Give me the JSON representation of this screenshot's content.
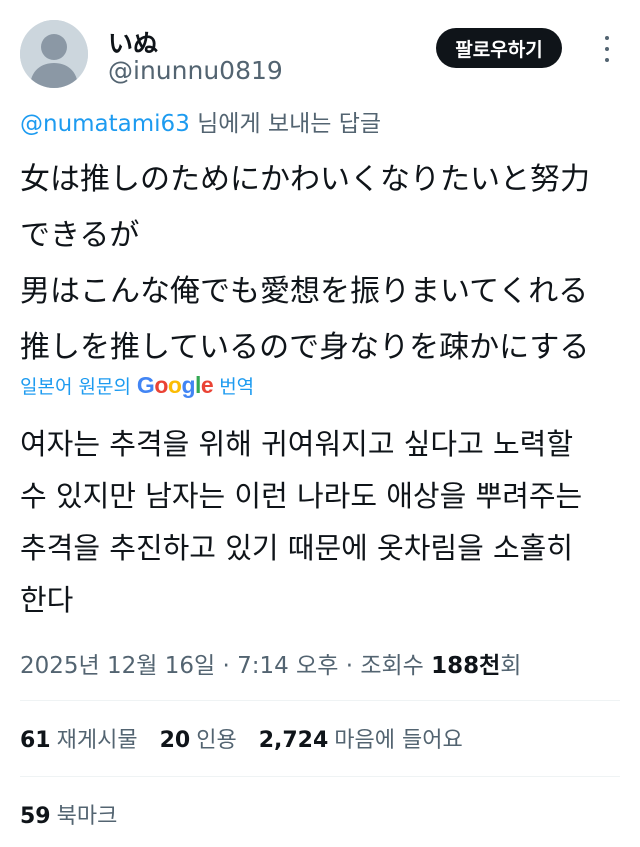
{
  "user": {
    "display_name": "いぬ",
    "handle": "@inunnu0819",
    "avatar_icon": "default-avatar-icon"
  },
  "actions": {
    "follow_label": "팔로우하기",
    "more_icon": "more-options-icon"
  },
  "reply": {
    "mention": "@numatami63",
    "suffix": " 님에게 보내는 답글"
  },
  "tweet": {
    "lines": [
      "女は推しのためにかわいくなりたいと努力",
      "できるが",
      "男はこんな俺でも愛想を振りまいてくれる",
      "推しを推しているので身なりを疎かにする"
    ]
  },
  "translation": {
    "prefix": "일본어 원문의",
    "brand": "Google",
    "suffix": "번역",
    "lines": [
      "여자는 추격을 위해 귀여워지고 싶다고 노력할",
      "수 있지만 남자는 이런 나라도 애상을 뿌려주는",
      "추격을 추진하고 있기 때문에 옷차림을 소홀히",
      "한다"
    ]
  },
  "meta": {
    "datetime": "2025년 12월 16일 · 7:14 오후 · 조회수 ",
    "views": "188천",
    "views_suffix": "회"
  },
  "stats": {
    "retweets_count": "61",
    "retweets_label": "재게시물",
    "quotes_count": "20",
    "quotes_label": "인용",
    "likes_count": "2,724",
    "likes_label": "마음에 들어요",
    "bookmarks_count": "59",
    "bookmarks_label": "북마크"
  },
  "colors": {
    "accent": "#1d9bf0",
    "text_primary": "#0f1419",
    "text_secondary": "#536471",
    "follow_bg": "#0f1419"
  }
}
